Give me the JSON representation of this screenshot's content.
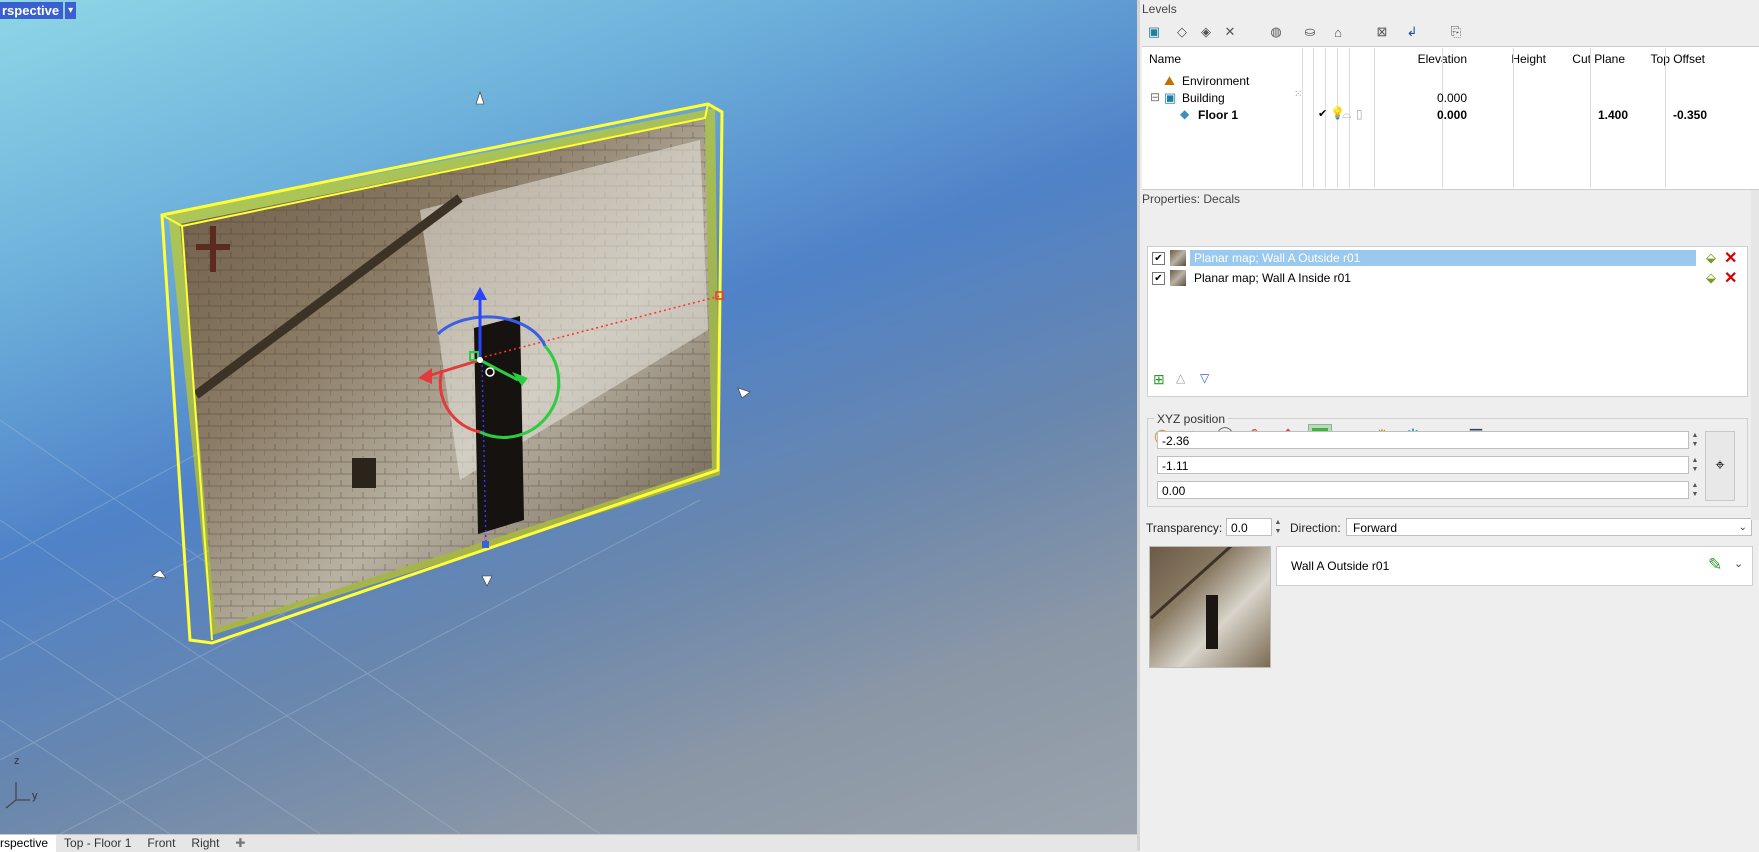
{
  "viewport": {
    "active_view": "rspective",
    "dropdown_icon": "chevron-down-icon",
    "tabs": [
      "rspective",
      "Top - Floor 1",
      "Front",
      "Right"
    ],
    "add_tab_icon": "plus-icon",
    "axis": {
      "z": "z",
      "y": "y"
    }
  },
  "levels": {
    "title": "Levels",
    "columns": [
      "Name",
      "Elevation",
      "Height",
      "Cut Plane",
      "Top Offset"
    ],
    "rows": [
      {
        "name": "Environment",
        "elevation": "",
        "height": "",
        "cut_plane": "",
        "top_offset": ""
      },
      {
        "name": "Building",
        "elevation": "0.000",
        "height": "",
        "cut_plane": "",
        "top_offset": ""
      },
      {
        "name": "Floor 1",
        "elevation": "0.000",
        "height": "",
        "cut_plane": "1.400",
        "top_offset": "-0.350"
      }
    ],
    "collapse_symbol": "⊟"
  },
  "properties": {
    "title": "Properties: Decals",
    "decals": [
      {
        "label": "Planar map; Wall A Outside r01",
        "checked": true,
        "selected": true
      },
      {
        "label": "Planar map; Wall A Inside r01",
        "checked": true,
        "selected": false
      }
    ],
    "xyz_label": "XYZ position",
    "xyz": [
      "-2.36",
      "-1.11",
      "0.00"
    ],
    "transparency_label": "Transparency:",
    "transparency": "0.0",
    "direction_label": "Direction:",
    "direction": "Forward",
    "texture_name": "Wall A Outside r01"
  },
  "colors": {
    "accent": "#3a5fd0",
    "selection": "#99c9ef",
    "selection_gizmo": "#ffff33"
  }
}
